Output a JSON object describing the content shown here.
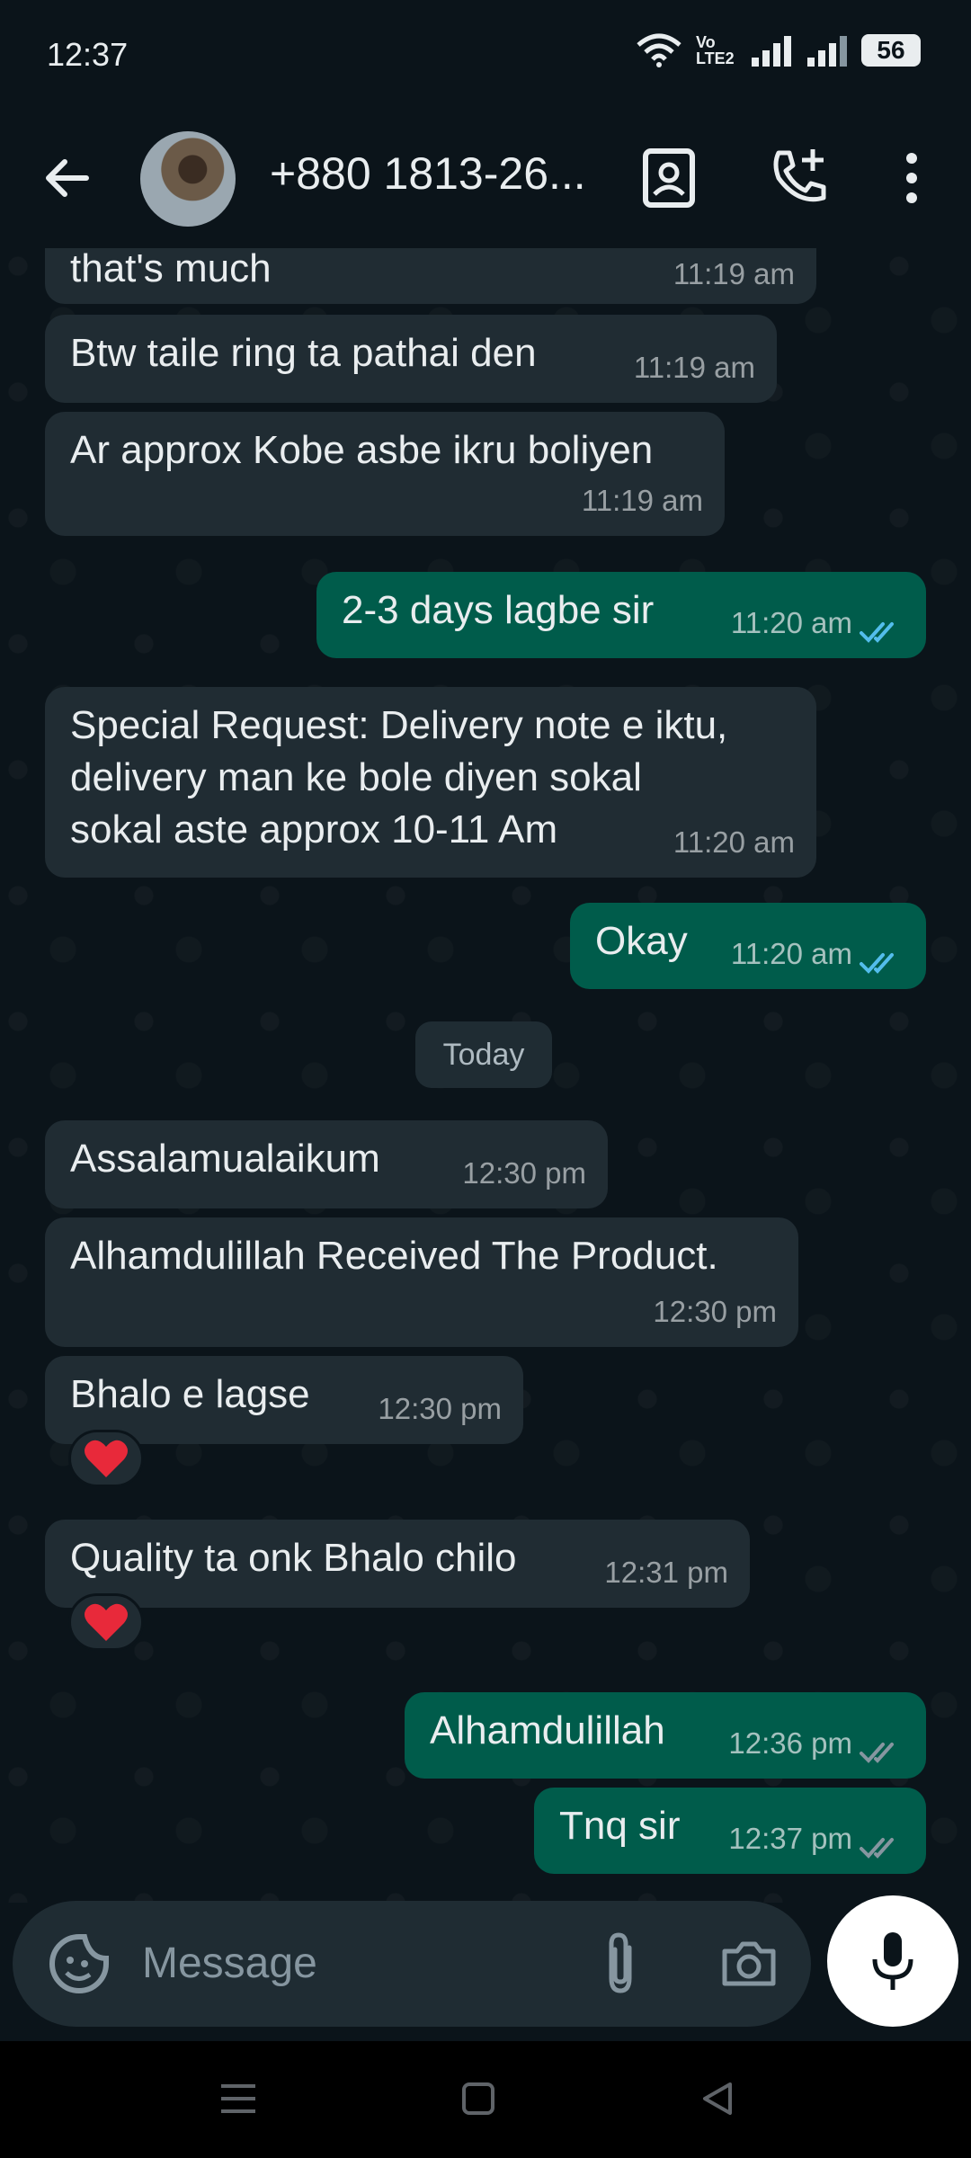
{
  "status_bar": {
    "time": "12:37",
    "battery": "56",
    "network": "Vo LTE2"
  },
  "header": {
    "contact_name": "+880 1813-26..."
  },
  "chat": {
    "messages": [
      {
        "dir": "in",
        "text": "that's much",
        "time": "11:19 am"
      },
      {
        "dir": "in",
        "text": "Btw taile ring ta pathai den",
        "time": "11:19 am"
      },
      {
        "dir": "in",
        "text": "Ar approx Kobe asbe ikru boliyen",
        "time": "11:19 am"
      },
      {
        "dir": "out",
        "text": "2-3 days lagbe sir",
        "time": "11:20 am"
      },
      {
        "dir": "in",
        "text_lines": [
          "Special Request: Delivery note e iktu,",
          "delivery man ke bole diyen sokal",
          "sokal aste approx 10-11 Am"
        ],
        "time": "11:20 am"
      },
      {
        "dir": "out",
        "text": "Okay",
        "time": "11:20 am"
      },
      {
        "dir": "in",
        "text": "Assalamualaikum",
        "time": "12:30 pm"
      },
      {
        "dir": "in",
        "text": "Alhamdulillah Received The Product.",
        "time": "12:30 pm"
      },
      {
        "dir": "in",
        "text": "Bhalo e lagse",
        "time": "12:30 pm",
        "reaction": "heart"
      },
      {
        "dir": "in",
        "text": "Quality ta onk Bhalo chilo",
        "time": "12:31 pm",
        "reaction": "heart"
      },
      {
        "dir": "out",
        "text": "Alhamdulillah",
        "time": "12:36 pm"
      },
      {
        "dir": "out",
        "text": "Tnq sir",
        "time": "12:37 pm"
      }
    ],
    "day_divider": "Today"
  },
  "input": {
    "placeholder": "Message"
  },
  "colors": {
    "incoming": "#202c33",
    "outgoing": "#005c4b",
    "read_tick": "#53bdeb",
    "delivered_tick": "#8696a0"
  }
}
